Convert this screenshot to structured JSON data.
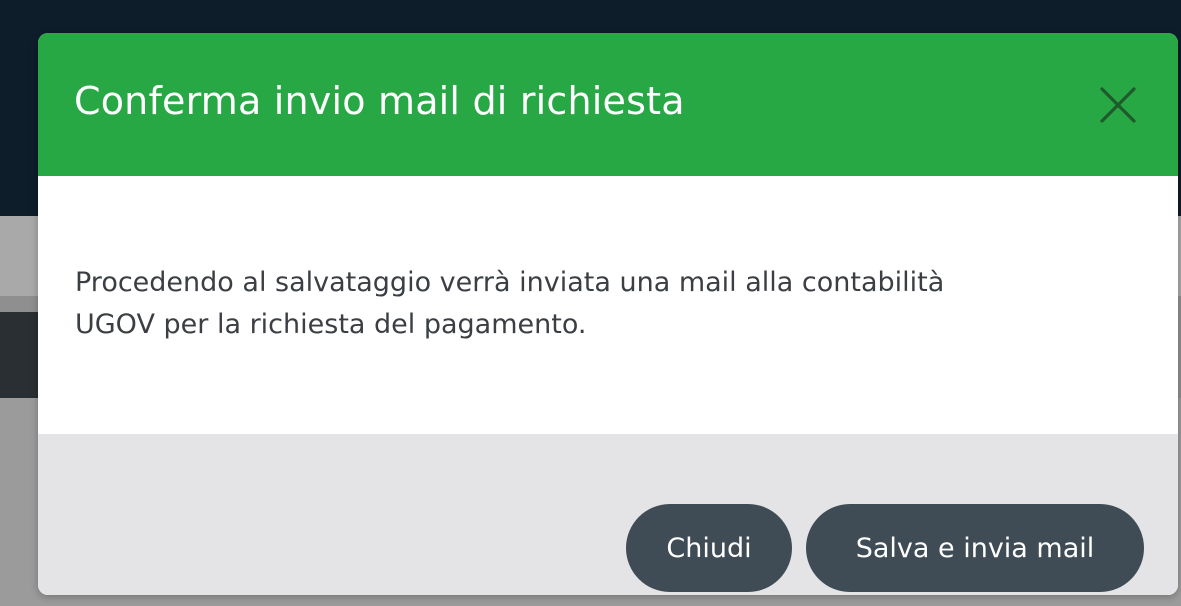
{
  "modal": {
    "title": "Conferma invio mail di richiesta",
    "close_icon": "close-icon",
    "message_line1": "Procedendo al salvataggio verrà inviata una mail alla contabilità",
    "message_line2": "UGOV per la richiesta del pagamento.",
    "buttons": {
      "close_label": "Chiudi",
      "save_label": "Salva e invia mail"
    }
  },
  "colors": {
    "header": "#28a745",
    "buttons": "#3f4b55",
    "footer": "#e4e4e6",
    "backdrop_navbar": "#0d1d2a"
  }
}
